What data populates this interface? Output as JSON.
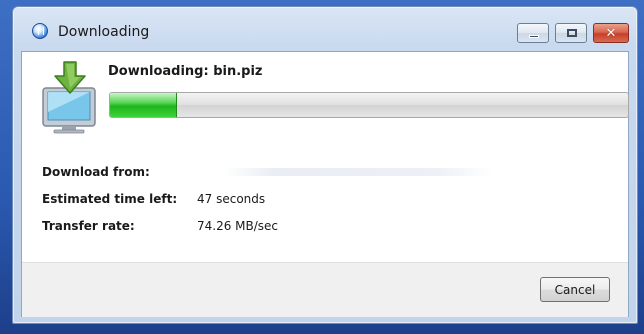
{
  "window": {
    "title": "Downloading",
    "caption_buttons": {
      "minimize_icon": "minimize-icon",
      "maximize_icon": "maximize-icon",
      "close_icon": "close-icon",
      "close_glyph": "✕"
    }
  },
  "download": {
    "heading": "Downloading: bin.piz",
    "progress_fraction": 0.13,
    "icon": "download-monitor-icon"
  },
  "details": {
    "from_label": "Download from:",
    "from_value": "",
    "time_label": "Estimated time left:",
    "time_value": "47 seconds",
    "rate_label": "Transfer rate:",
    "rate_value": "74.26 MB/sec"
  },
  "footer": {
    "cancel_label": "Cancel"
  },
  "colors": {
    "progress_fill": "#20b51c",
    "close_button": "#c7402a",
    "titlebar": "#c9d9ee"
  }
}
